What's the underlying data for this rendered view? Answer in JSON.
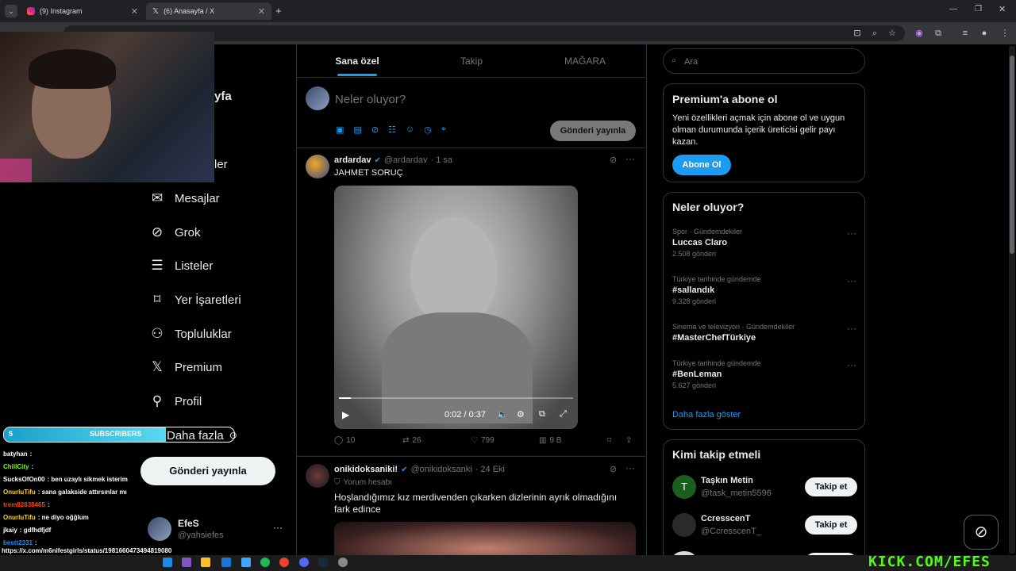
{
  "browser": {
    "tabs": [
      {
        "label": "(9) Instagram",
        "icon": "instagram-icon"
      },
      {
        "label": "(6) Anasayfa / X",
        "icon": "x-logo-icon"
      }
    ],
    "new_tab": "+"
  },
  "sidebar": {
    "partial_home": "yfa",
    "partial_notifications": "ler",
    "items": [
      {
        "label": "Mesajlar",
        "icon": "mail-icon"
      },
      {
        "label": "Grok",
        "icon": "grok-icon"
      },
      {
        "label": "Listeler",
        "icon": "list-icon"
      },
      {
        "label": "Yer İşaretleri",
        "icon": "bookmark-icon"
      },
      {
        "label": "Topluluklar",
        "icon": "communities-icon"
      },
      {
        "label": "Premium",
        "icon": "x-logo-icon"
      },
      {
        "label": "Profil",
        "icon": "profile-icon"
      },
      {
        "label": "Daha fazla",
        "icon": "more-icon"
      }
    ],
    "post_button": "Gönderi yayınla",
    "account": {
      "name": "EfeS",
      "handle": "@yahsiefes",
      "more": "···"
    }
  },
  "feed": {
    "tabs": [
      "Sana özel",
      "Takip",
      "MAĞARA"
    ],
    "active_tab": 0,
    "composer": {
      "placeholder": "Neler oluyor?",
      "post_button": "Gönderi yayınla"
    },
    "posts": [
      {
        "name": "ardardav",
        "handle": "@ardardav",
        "time": "· 1 sa",
        "text": "JAHMET SORUÇ",
        "video": {
          "time": "0:02 / 0:37",
          "progress": 0.05
        },
        "actions": {
          "replies": "10",
          "reposts": "26",
          "likes": "799",
          "views": "9 B"
        }
      },
      {
        "name": "onikidoksaniki!",
        "handle": "@onikidoksanki",
        "time": "· 24 Eki",
        "label": "Yorum hesabı",
        "text": "Hoşlandığımız kız merdivenden çıkarken dizlerinin ayrık olmadığını fark edince"
      }
    ]
  },
  "right": {
    "search_placeholder": "Ara",
    "premium": {
      "title": "Premium'a abone ol",
      "text": "Yeni özellikleri açmak için abone ol ve uygun olman durumunda içerik üreticisi gelir payı kazan.",
      "button": "Abone Ol"
    },
    "trends": {
      "title": "Neler oluyor?",
      "items": [
        {
          "category": "Spor · Gündemdekiler",
          "name": "Luccas Claro",
          "count": "2.508 gönderi"
        },
        {
          "category": "Türkiye tarihinde gündemde",
          "name": "#sallandık",
          "count": "9.328 gönderi"
        },
        {
          "category": "Sinema ve televizyon · Gündemdekiler",
          "name": "#MasterChefTürkiye",
          "count": ""
        },
        {
          "category": "Türkiye tarihinde gündemde",
          "name": "#BenLeman",
          "count": "5.627 gönderi"
        }
      ],
      "more": "Daha fazla göster"
    },
    "who_to_follow": {
      "title": "Kimi takip etmeli",
      "items": [
        {
          "name": "Taşkın Metin",
          "handle": "@task_metin5596",
          "button": "Takip et",
          "avatar": "T"
        },
        {
          "name": "CcresscenT",
          "handle": "@CcresscenT_",
          "button": "Takip et",
          "avatar": ""
        }
      ]
    }
  },
  "stream": {
    "subscribers_count": "5",
    "subscribers_label": "SUBSCRIBERS",
    "chat": [
      {
        "user": "batyhan",
        "msg": ":",
        "color": "#ffffff"
      },
      {
        "user": "ChillCity",
        "msg": ":",
        "color": "#7cfc00"
      },
      {
        "user": "SucksOfOn00",
        "msg": ": ben uzaylı sikmek isterim",
        "color": "#ffffff"
      },
      {
        "user": "OnurluTifu",
        "msg": ": sana galakside attırsınlar mı",
        "color": "#ffd700"
      },
      {
        "user": "trem82838465",
        "msg": ":",
        "color": "#ff4500"
      },
      {
        "user": "OnurluTifu",
        "msg": ": ne diyo oğğlum",
        "color": "#ffd700"
      },
      {
        "user": "jkaiy",
        "msg": ": gdfhdfjdf",
        "color": "#ffffff"
      },
      {
        "user": "bestt2331",
        "msg": ":",
        "color": "#1e90ff"
      }
    ],
    "status_url": "https://x.com/m6nifestgirls/status/1981660473494819080",
    "watermark": "KICK.COM/EFES"
  }
}
